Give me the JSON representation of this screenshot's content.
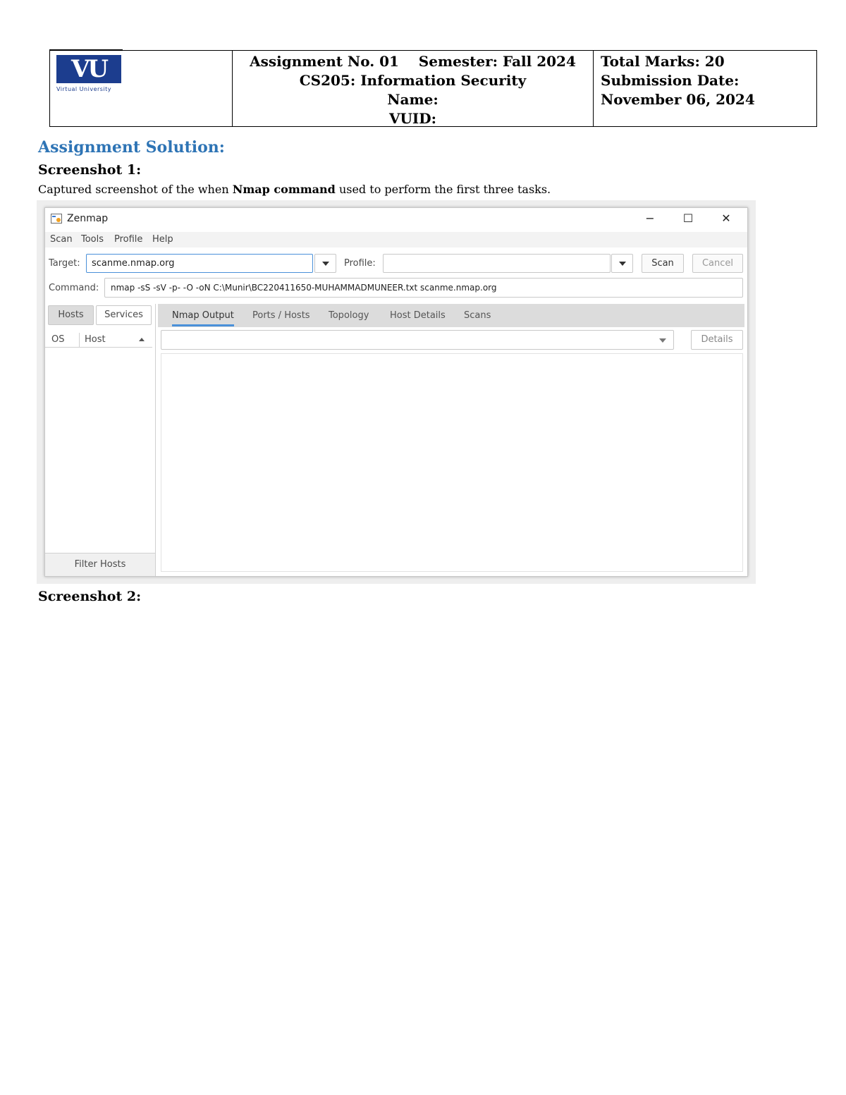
{
  "header": {
    "logo_text": "VU",
    "logo_sub": "Virtual University",
    "assignment_line": "Assignment No. 01    Semester: Fall 2024",
    "course": "CS205: Information Security",
    "name_label": "Name:",
    "vuid_label": "VUID:",
    "total_marks": "Total Marks: 20",
    "submission_label": "Submission Date:",
    "submission_date": "November 06, 2024"
  },
  "body": {
    "heading": "Assignment Solution:",
    "screenshot1_label": "Screenshot 1:",
    "caption_before": "Captured screenshot of the when ",
    "caption_bold": "Nmap command",
    "caption_after": " used to perform the first three tasks.",
    "screenshot2_label": "Screenshot 2:"
  },
  "zenmap": {
    "title": "Zenmap",
    "window_controls": {
      "minimize": "−",
      "maximize": "☐",
      "close": "✕"
    },
    "menu": [
      "Scan",
      "Tools",
      "Profile",
      "Help"
    ],
    "target_label": "Target:",
    "target_value": "scanme.nmap.org",
    "profile_label": "Profile:",
    "profile_value": "",
    "scan_button": "Scan",
    "cancel_button": "Cancel",
    "command_label": "Command:",
    "command_value": "nmap -sS -sV -p- -O -oN C:\\Munir\\BC220411650-MUHAMMADMUNEER.txt scanme.nmap.org",
    "hosts_tab": "Hosts",
    "services_tab": "Services",
    "col_os": "OS",
    "col_host": "Host",
    "filter_hosts": "Filter Hosts",
    "tabs": [
      "Nmap Output",
      "Ports / Hosts",
      "Topology",
      "Host Details",
      "Scans"
    ],
    "details_button": "Details",
    "accent_color": "#4a90d9"
  }
}
